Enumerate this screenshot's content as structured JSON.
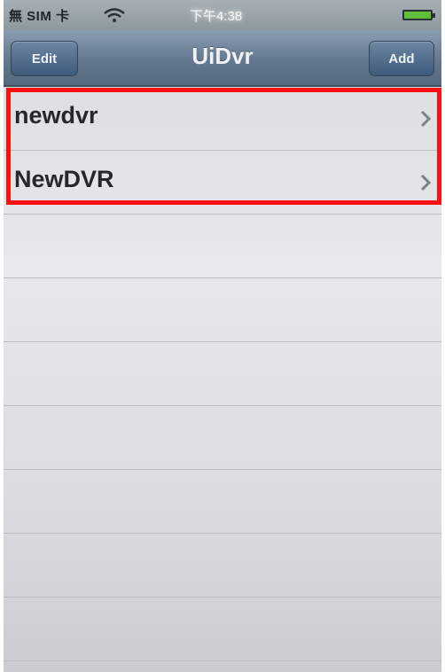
{
  "status_bar": {
    "carrier": "無 SIM 卡",
    "time": "下午4:38"
  },
  "nav_bar": {
    "title": "UiDvr",
    "left_button": "Edit",
    "right_button": "Add"
  },
  "table": {
    "rows": [
      {
        "label": "newdvr"
      },
      {
        "label": "NewDVR"
      }
    ]
  },
  "colors": {
    "highlight": "#ff1010",
    "nav_bar": "#64788f"
  }
}
